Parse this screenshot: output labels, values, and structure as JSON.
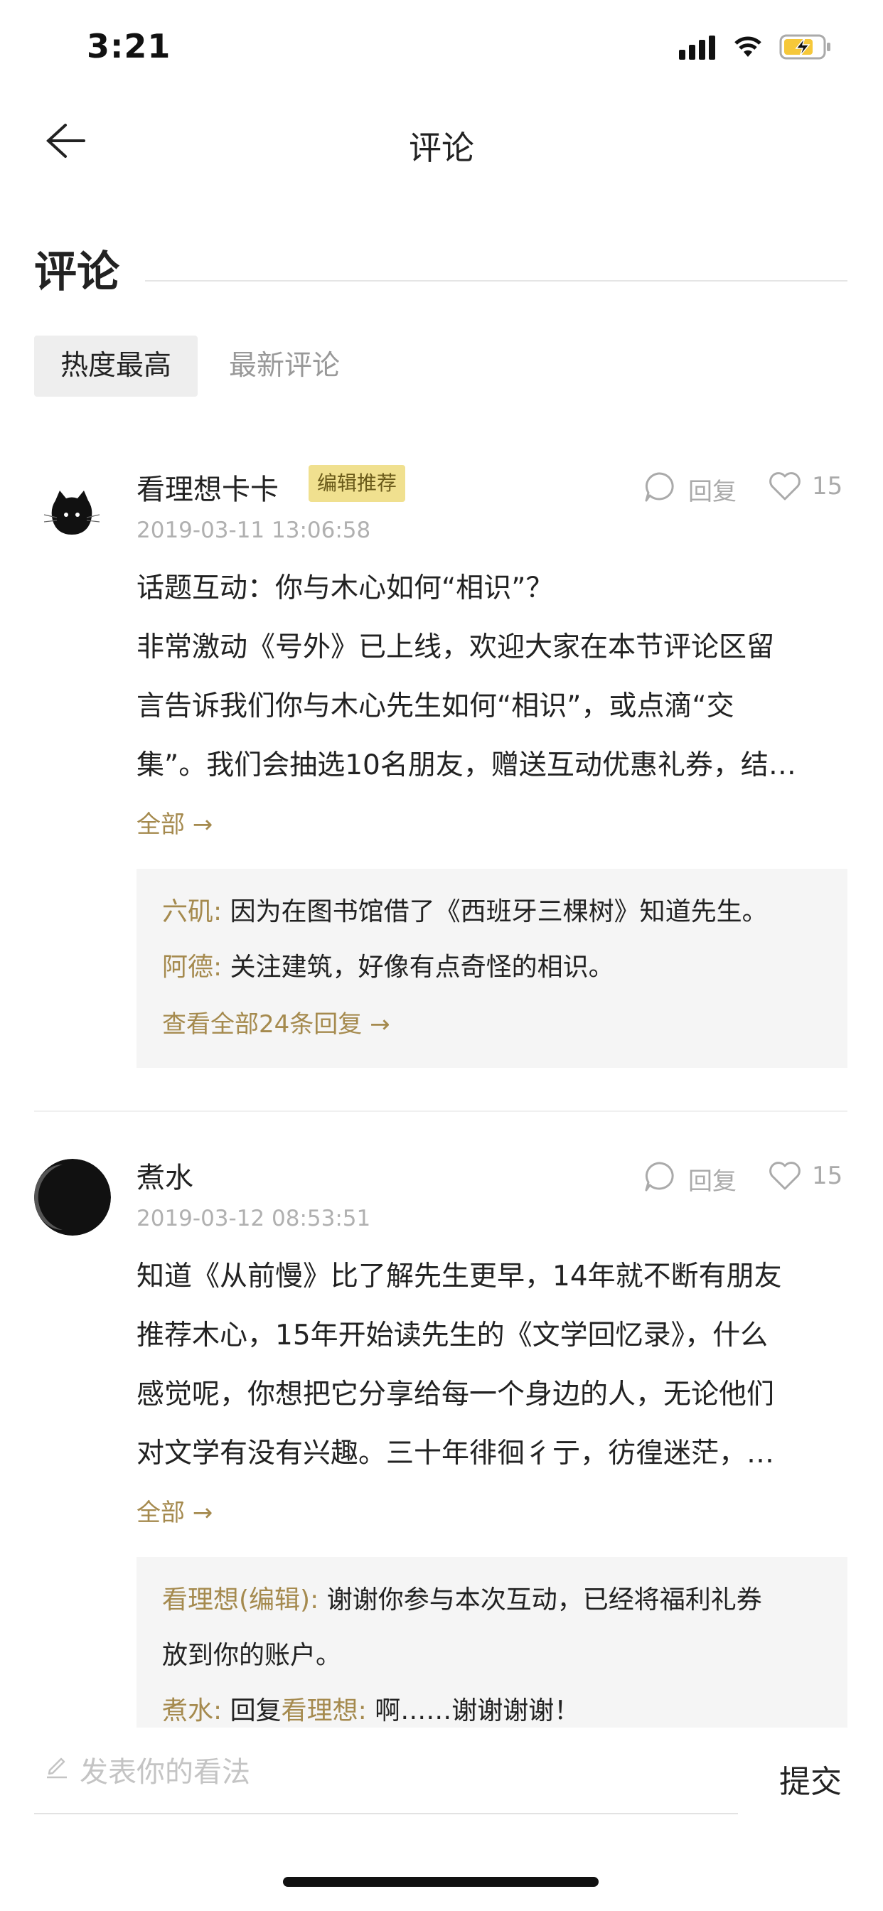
{
  "status_bar": {
    "time": "3:21"
  },
  "nav": {
    "title": "评论"
  },
  "section": {
    "title": "评论"
  },
  "tabs": [
    {
      "label": "热度最高",
      "active": true
    },
    {
      "label": "最新评论",
      "active": false
    }
  ],
  "comments": [
    {
      "user": "看理想卡卡",
      "badge": "编辑推荐",
      "time": "2019-03-11 13:06:58",
      "reply_label": "回复",
      "likes": "15",
      "lines": [
        "话题互动：你与木心如何“相识”？",
        "非常激动《号外》已上线，欢迎大家在本节评论区留",
        "言告诉我们你与木心先生如何“相识”，或点滴“交",
        "集”。我们会抽选10名朋友，赠送互动优惠礼券，结…"
      ],
      "more": "全部 →",
      "replies": [
        {
          "name": "六矶:",
          "text": "因为在图书馆借了《西班牙三棵树》知道先生。"
        },
        {
          "name": "阿德:",
          "text": "关注建筑，好像有点奇怪的相识。"
        }
      ],
      "view_all": "查看全部24条回复 →"
    },
    {
      "user": "煮水",
      "time": "2019-03-12 08:53:51",
      "reply_label": "回复",
      "likes": "15",
      "lines": [
        "知道《从前慢》比了解先生更早，14年就不断有朋友",
        "推荐木心，15年开始读先生的《文学回忆录》，什么",
        "感觉呢，你想把它分享给每一个身边的人，无论他们",
        "对文学有没有兴趣。三十年徘徊彳亍，彷徨迷茫，…"
      ],
      "more": "全部 →",
      "replies": [
        {
          "name": "看理想(编辑):",
          "text": "谢谢你参与本次互动，已经将福利礼券"
        },
        {
          "text": "放到你的账户。"
        },
        {
          "name": "煮水:",
          "text": " 回复",
          "name2": "看理想:",
          "text2": "啊……谢谢谢谢！"
        }
      ]
    }
  ],
  "composer": {
    "placeholder": "发表你的看法",
    "submit": "提交"
  },
  "colors": {
    "accent": "#a58a4e",
    "badge_bg": "#f0e08f"
  }
}
